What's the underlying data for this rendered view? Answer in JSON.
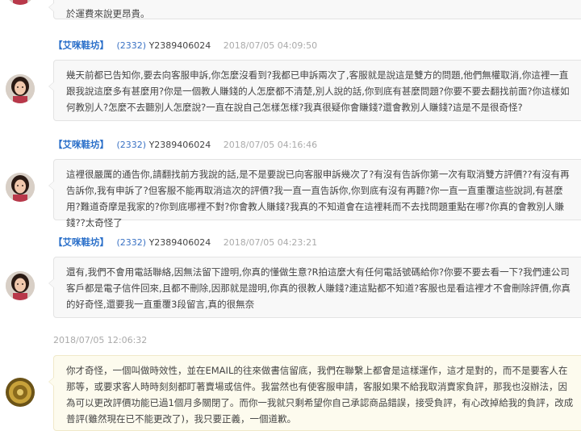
{
  "thread": {
    "top_fragment": "於運費來說更昂貴。",
    "messages": [
      {
        "name": "【艾咪鞋坊】",
        "uid": "(2332)",
        "account": "Y2389406024",
        "time": "2018/07/05 04:09:50",
        "text": "幾天前都已告知你,要去向客服申訴,你怎麼沒看到?我都已申訴兩次了,客服就是說這是雙方的問題,他們無權取消,你這裡一直跟我說這麼多有甚麼用?你是一個教人賺錢的人怎麼都不清楚,別人說的話,你到底有甚麼問題?你要不要去翻找前面?你這樣如何教別人?怎麼不去聽別人怎麼說?一直在說自己怎樣怎樣?我真很疑你會賺錢?還會教別人賺錢?這是不是很奇怪?"
      },
      {
        "name": "【艾咪鞋坊】",
        "uid": "(2332)",
        "account": "Y2389406024",
        "time": "2018/07/05 04:16:46",
        "text": "這裡很嚴厲的通告你,請翻找前方我說的話,是不是要說已向客服申訴幾次了?有沒有告訴你第一次有取消雙方評價??有沒有再告訴你,我有申訴了?但客服不能再取消這次的評價?我一直一直告訴你,你到底有沒有再聽?你一直一直重覆這些說詞,有甚麼用?難道奇摩是我家的?你到底哪裡不對?你會教人賺錢?我真的不知道會在這裡耗而不去找問題重點在哪?你真的會教別人賺錢??太奇怪了"
      },
      {
        "name": "【艾咪鞋坊】",
        "uid": "(2332)",
        "account": "Y2389406024",
        "time": "2018/07/05 04:23:21",
        "text": "還有,我們不會用電話聯絡,因無法留下證明,你真的懂做生意?R拍這麼大有任何電話號碼給你?你要不要去看一下?我們連公司客戶都是電子信件回來,且都不刪除,因那就是證明,你真的很教人賺錢?連這點都不知道?客服也是看這裡才不會刪除評價,你真的好奇怪,還要我一直重覆3段留言,真的很無奈"
      }
    ],
    "reply": {
      "time": "2018/07/05 12:06:32",
      "text": "你才奇怪，一個叫做時效性，並在EMAIL的往來做書信留底，我們在聯繫上都會是這樣運作，這才是對的，而不是要客人在那等，或要求客人時時刻刻都盯著賣場或信件。我當然也有使客服申請，客服如果不給我取消賣家負評，那我也沒辦法，因為可以更改評價功能已過1個月多關閉了。而你一我就只剩希望你自己承認商品錯誤，接受負評，有心改掉給我的負評，改成普評(雖然現在已不能更改了)，我只要正義，一個道歉。"
    }
  }
}
